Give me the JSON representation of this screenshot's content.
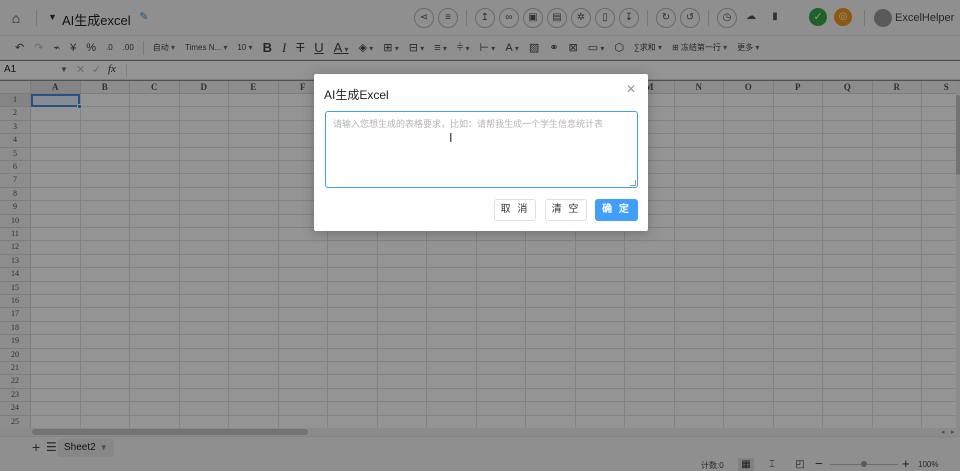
{
  "app": {
    "doc_title": "AI生成excel",
    "user_name": "ExcelHelper"
  },
  "toolbar": {
    "undo": "↶",
    "redo": "↷",
    "format_painter": "⌁",
    "currency": "¥",
    "percent": "%",
    "decrease_decimal": ".0",
    "increase_decimal": ".00",
    "number_format": "自动",
    "font_family": "Times N...",
    "font_size": "10",
    "bold": "B",
    "italic": "I",
    "strikethrough": "T",
    "underline": "U",
    "text_color": "A",
    "sum_label": "求和",
    "freeze_label": "冻结第一行",
    "more_label": "更多"
  },
  "formula_bar": {
    "cell_ref": "A1",
    "fx": "fx"
  },
  "grid": {
    "columns": [
      "A",
      "B",
      "C",
      "D",
      "E",
      "F",
      "G",
      "H",
      "I",
      "J",
      "K",
      "L",
      "M",
      "N",
      "O",
      "P",
      "Q",
      "R",
      "S"
    ],
    "rows": [
      "1",
      "2",
      "3",
      "4",
      "5",
      "6",
      "7",
      "8",
      "9",
      "10",
      "11",
      "12",
      "13",
      "14",
      "15",
      "16",
      "17",
      "18",
      "19",
      "20",
      "21",
      "22",
      "23",
      "24",
      "25"
    ],
    "selected_cell": "A1"
  },
  "sheets": {
    "active": "Sheet2"
  },
  "statusbar": {
    "count": "计数:0",
    "zoom": "100%",
    "zoom_fraction": 1.0
  },
  "dialog": {
    "title": "AI生成Excel",
    "placeholder": "请输入您想生成的表格要求，比如：请帮我生成一个学生信息统计表",
    "value": "",
    "cancel_label": "取 消",
    "clear_label": "清 空",
    "ok_label": "确 定"
  }
}
